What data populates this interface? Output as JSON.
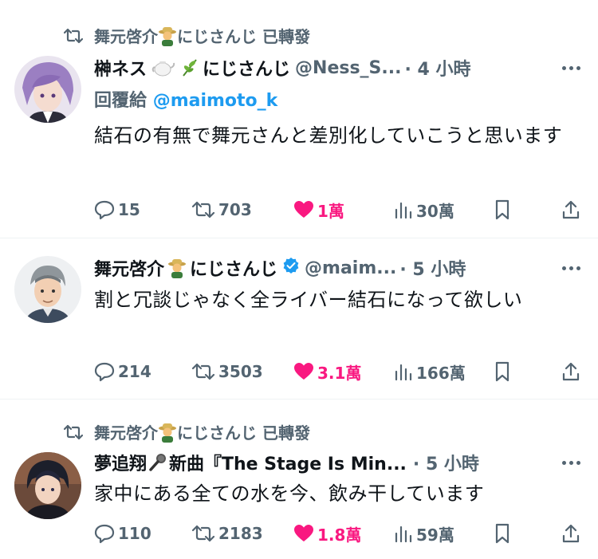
{
  "tweets": [
    {
      "retweeted_by": "舞元啓介",
      "retweeted_suffix": "にじさんじ 已轉發",
      "name": "榊ネス",
      "name_suffix": "にじさんじ",
      "handle": "@Ness_S...",
      "time": "· 4 小時",
      "reply_prefix": "回覆給",
      "reply_mention": "@maimoto_k",
      "text": "結石の有無で舞元さんと差別化していこうと思います",
      "replies": "15",
      "retweets": "703",
      "likes": "1萬",
      "views": "30萬"
    },
    {
      "name": "舞元啓介",
      "name_suffix": "にじさんじ",
      "handle": "@maim...",
      "time": "· 5 小時",
      "text": "割と冗談じゃなく全ライバー結石になって欲しい",
      "replies": "214",
      "retweets": "3503",
      "likes": "3.1萬",
      "views": "166萬"
    },
    {
      "retweeted_by": "舞元啓介",
      "retweeted_suffix": "にじさんじ 已轉發",
      "name": "夢追翔",
      "name_suffix": "新曲『The Stage Is Min...",
      "time": "· 5 小時",
      "text": "家中にある全ての水を今、飲み干しています",
      "replies": "110",
      "retweets": "2183",
      "likes": "1.8萬",
      "views": "59萬"
    }
  ],
  "colors": {
    "like": "#f91880",
    "link": "#1d9bf0",
    "muted": "#536471",
    "verified": "#1d9bf0"
  }
}
